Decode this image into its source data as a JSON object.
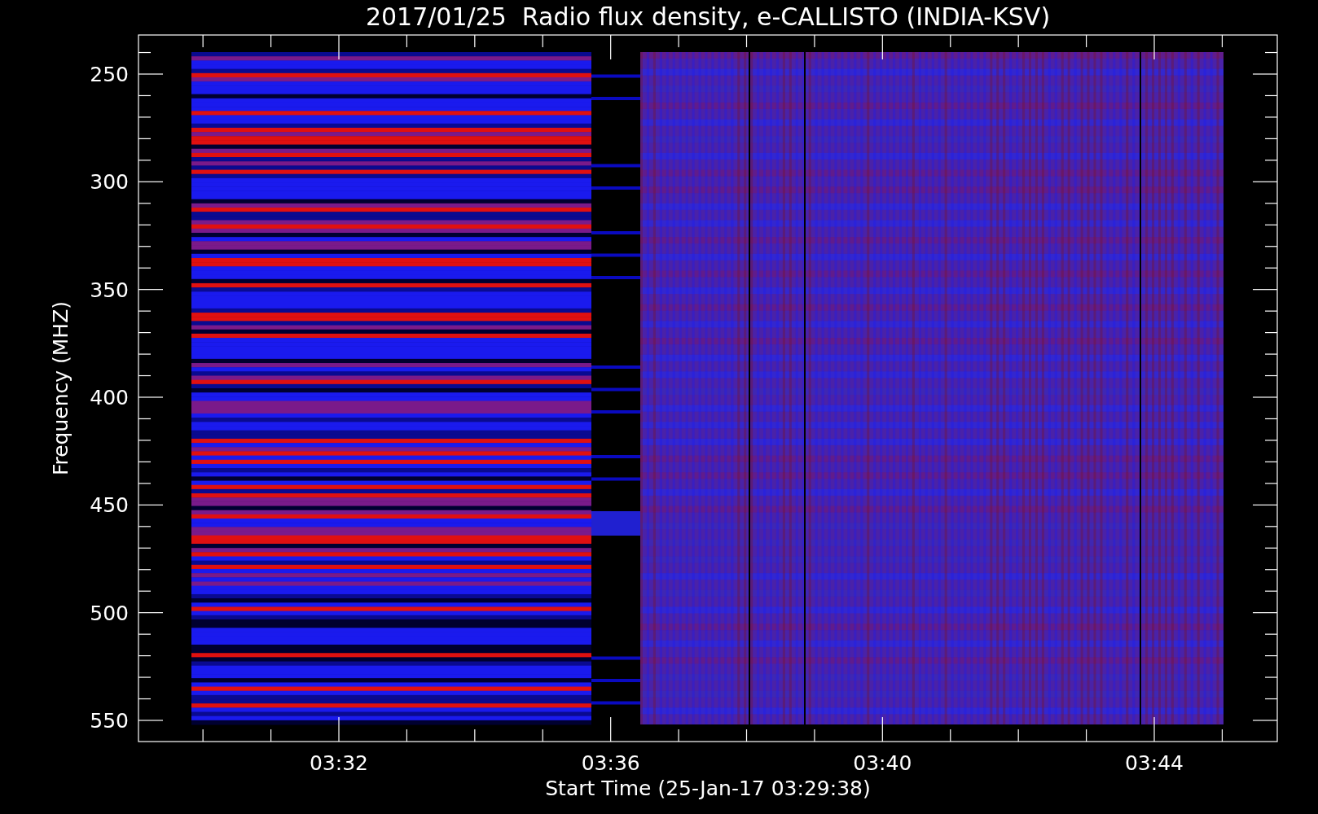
{
  "title": "2017/01/25  Radio flux density, e-CALLISTO (INDIA-KSV)",
  "y_axis": {
    "label": "Frequency (MHZ)",
    "ticks": [
      "250",
      "300",
      "350",
      "400",
      "450",
      "500",
      "550"
    ]
  },
  "x_axis": {
    "label": "Start Time (25-Jan-17 03:29:38)",
    "ticks": [
      "03:32",
      "03:36",
      "03:40",
      "03:44"
    ]
  }
}
